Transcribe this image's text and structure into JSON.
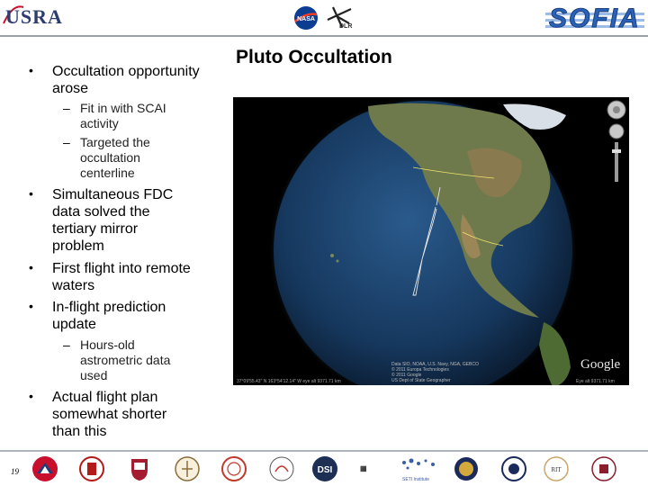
{
  "header": {
    "usra_logo_text": "USRA",
    "nasa_logo_text": "NASA",
    "dlr_logo_text": "DLR",
    "sofia_logo_text": "SOFIA"
  },
  "slide": {
    "title": "Pluto Occultation",
    "bullets": [
      {
        "text": "Occultation opportunity arose",
        "subs": [
          "Fit in with SCAI activity",
          "Targeted the occultation centerline"
        ]
      },
      {
        "text": "Simultaneous FDC data solved the tertiary mirror problem",
        "subs": []
      },
      {
        "text": "First flight into remote waters",
        "subs": []
      },
      {
        "text": "In-flight prediction update",
        "subs": [
          "Hours-old astrometric data used"
        ]
      },
      {
        "text": "Actual flight plan somewhat shorter than this",
        "subs": []
      }
    ]
  },
  "globe": {
    "watermark": "Google",
    "attribution": "Data SIO, NOAA, U.S. Navy, NGA, GEBCO\n© 2011 Europa Technologies\n© 2011 Google\nUS Dept of State Geographer",
    "coords": "37°09'55.43\" N 163°54'12.14\" W eye alt 9371.71 km",
    "viewer": "Eye alt 9371.71 km"
  },
  "footer": {
    "page_number": "19",
    "dsi_logo_text": "DSI",
    "sfi_text": "SETI Institute",
    "rit_text": "RIT"
  }
}
